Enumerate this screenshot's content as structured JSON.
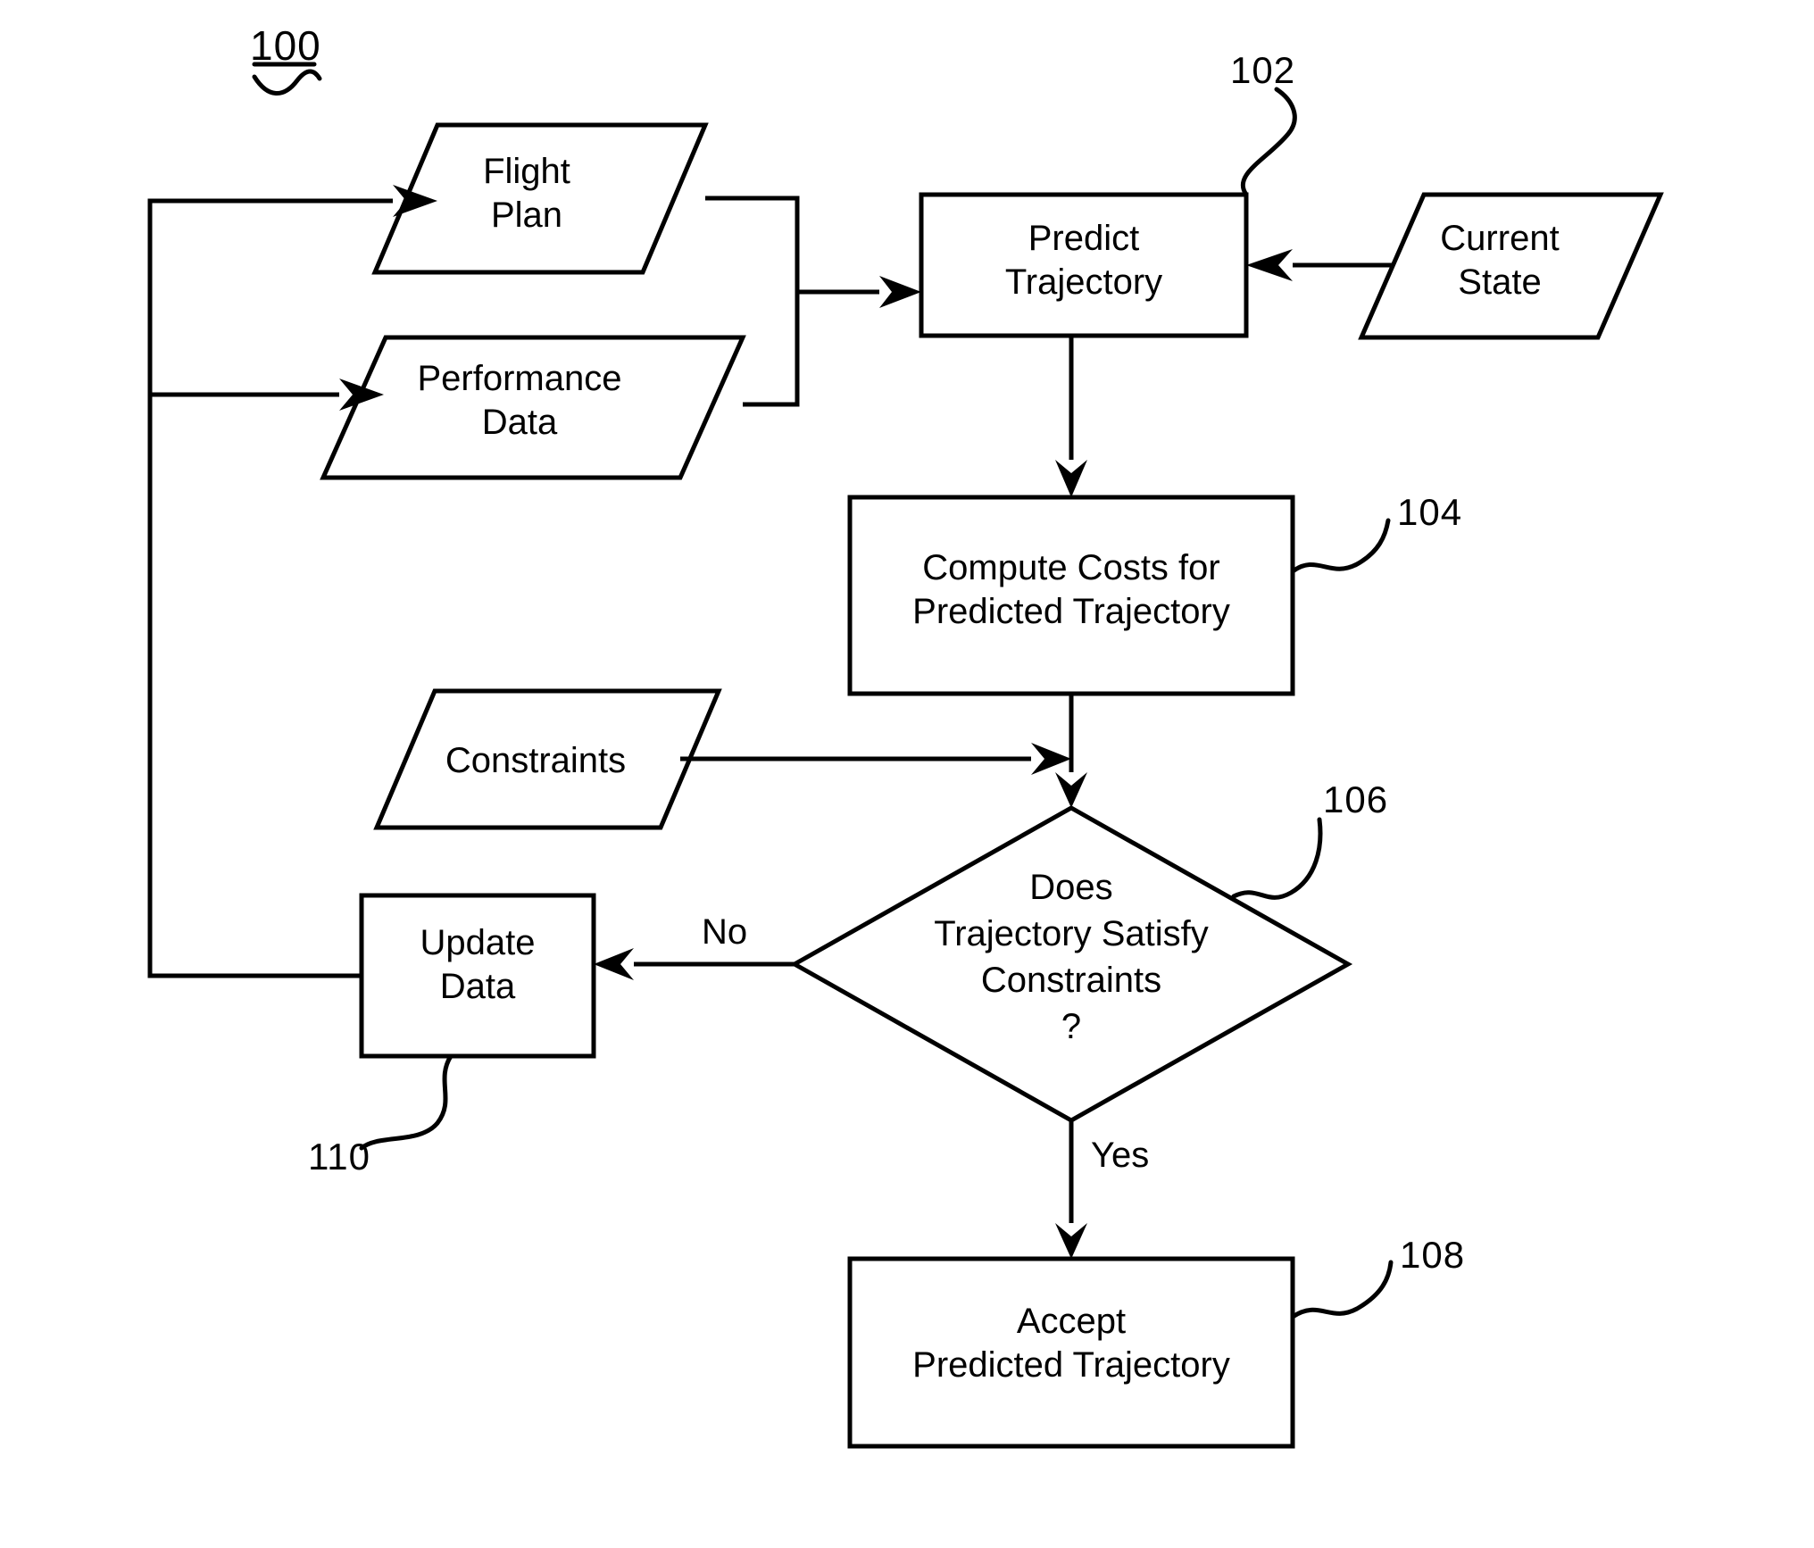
{
  "figure": {
    "reference_label": "100",
    "nodes": [
      {
        "id": "flight_plan",
        "shape": "parallelogram",
        "label": "Flight\nPlan"
      },
      {
        "id": "performance_data",
        "shape": "parallelogram",
        "label": "Performance\nData"
      },
      {
        "id": "predict",
        "shape": "process",
        "label": "Predict\nTrajectory",
        "ref": "102"
      },
      {
        "id": "current_state",
        "shape": "parallelogram",
        "label": "Current\nState"
      },
      {
        "id": "compute_costs",
        "shape": "process",
        "label": "Compute Costs for\nPredicted Trajectory",
        "ref": "104"
      },
      {
        "id": "constraints",
        "shape": "parallelogram",
        "label": "Constraints"
      },
      {
        "id": "decision",
        "shape": "diamond",
        "label": "Does\nTrajectory Satisfy\nConstraints\n?",
        "ref": "106"
      },
      {
        "id": "update_data",
        "shape": "process",
        "label": "Update\nData",
        "ref": "110"
      },
      {
        "id": "accept",
        "shape": "process",
        "label": "Accept\nPredicted Trajectory",
        "ref": "108"
      }
    ],
    "edge_labels": {
      "no": "No",
      "yes": "Yes"
    },
    "ref_numbers": {
      "figure": "100",
      "predict": "102",
      "compute_costs": "104",
      "decision": "106",
      "accept": "108",
      "update_data": "110"
    },
    "colors": {
      "stroke": "#000000",
      "fill": "#ffffff",
      "background": "#ffffff"
    }
  }
}
